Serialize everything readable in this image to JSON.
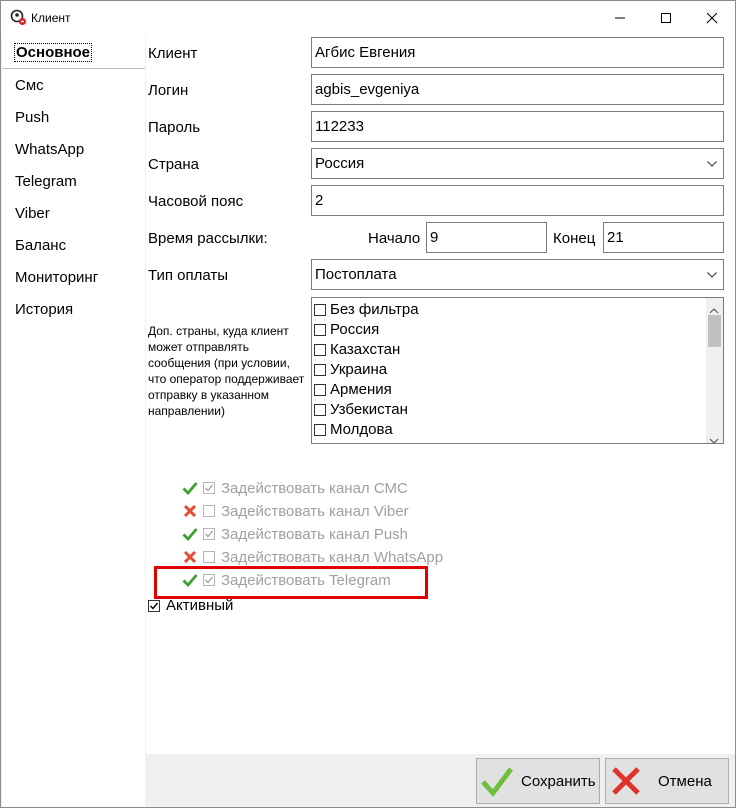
{
  "window": {
    "title": "Клиент"
  },
  "sidebar": {
    "items": [
      {
        "label": "Основное"
      },
      {
        "label": "Смс"
      },
      {
        "label": "Push"
      },
      {
        "label": "WhatsApp"
      },
      {
        "label": "Telegram"
      },
      {
        "label": "Viber"
      },
      {
        "label": "Баланс"
      },
      {
        "label": "Мониторинг"
      },
      {
        "label": "История"
      }
    ]
  },
  "form": {
    "client_label": "Клиент",
    "client_value": "Агбис Евгения",
    "login_label": "Логин",
    "login_value": "agbis_evgeniya",
    "password_label": "Пароль",
    "password_value": "112233",
    "country_label": "Страна",
    "country_value": "Россия",
    "timezone_label": "Часовой пояс",
    "timezone_value": "2",
    "sendtime_label": "Время рассылки:",
    "start_label": "Начало",
    "start_value": "9",
    "end_label": "Конец",
    "end_value": "21",
    "paytype_label": "Тип оплаты",
    "paytype_value": "Постоплата",
    "extra_countries_label": "Доп. страны, куда клиент может отправлять сообщения (при условии, что оператор поддерживает отправку в указанном направлении)",
    "extra_countries": [
      "Без фильтра",
      "Россия",
      "Казахстан",
      "Украина",
      "Армения",
      "Узбекистан",
      "Молдова"
    ]
  },
  "channels": [
    {
      "status": "green-check-icon",
      "checked": true,
      "label": "Задействовать канал СМС"
    },
    {
      "status": "red-cross-icon",
      "checked": false,
      "label": "Задействовать канал Viber"
    },
    {
      "status": "green-check-icon",
      "checked": true,
      "label": "Задействовать канал Push"
    },
    {
      "status": "red-cross-icon",
      "checked": false,
      "label": "Задействовать канал WhatsApp"
    },
    {
      "status": "green-check-icon",
      "checked": true,
      "label": "Задействовать Telegram"
    }
  ],
  "active": {
    "label": "Активный",
    "checked": true
  },
  "buttons": {
    "save_label": "Сохранить",
    "cancel_label": "Отмена"
  },
  "colors": {
    "highlight": "#e00000",
    "check_green": "#3aa12f",
    "cross_red": "#e24b35"
  }
}
